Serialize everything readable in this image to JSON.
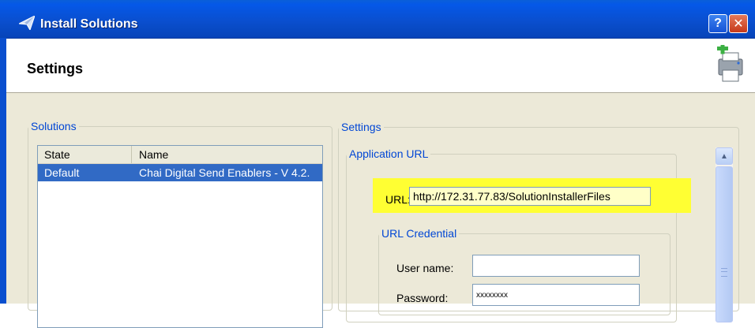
{
  "window": {
    "title": "Install Solutions"
  },
  "header": {
    "title": "Settings"
  },
  "solutions": {
    "legend": "Solutions",
    "columns": [
      "State",
      "Name"
    ],
    "rows": [
      {
        "state": "Default",
        "name": "Chai Digital Send Enablers - V 4.2."
      }
    ]
  },
  "settings": {
    "legend": "Settings",
    "app_url": {
      "legend": "Application URL",
      "url_label": "URL:",
      "url_value": "http://172.31.77.83/SolutionInstallerFiles"
    },
    "credential": {
      "legend": "URL Credential",
      "username_label": "User name:",
      "username_value": "",
      "password_label": "Password:",
      "password_value": "xxxxxxxx"
    }
  },
  "colors": {
    "highlight": "#ffff33",
    "title_bar": "#0a4fcf",
    "selected_row": "#316ac5"
  }
}
